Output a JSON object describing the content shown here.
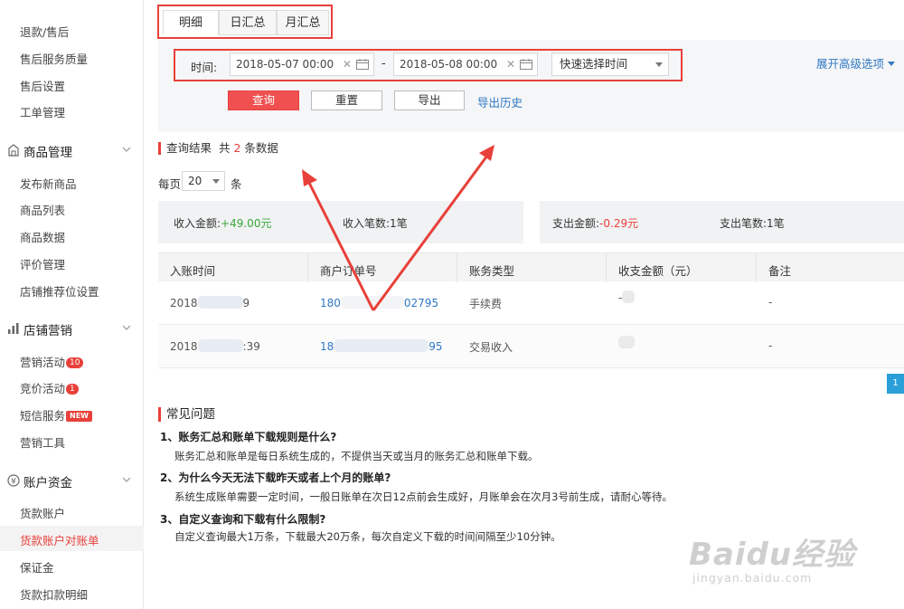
{
  "sidebar": {
    "top_items": [
      "退款/售后",
      "售后服务质量",
      "售后设置",
      "工单管理"
    ],
    "groups": [
      {
        "label": "商品管理",
        "items": [
          "发布新商品",
          "商品列表",
          "商品数据",
          "评价管理",
          "店铺推荐位设置"
        ]
      },
      {
        "label": "店铺营销",
        "items": [
          "营销活动",
          "竞价活动",
          "短信服务",
          "营销工具"
        ],
        "badges": {
          "营销活动": "10",
          "竞价活动": "1",
          "短信服务": "NEW"
        }
      },
      {
        "label": "账户资金",
        "items": [
          "货款账户",
          "货款账户对账单",
          "保证金",
          "货款扣款明细"
        ]
      }
    ],
    "active_item": "货款账户对账单"
  },
  "tabs": [
    "明细",
    "日汇总",
    "月汇总"
  ],
  "active_tab": "明细",
  "filter": {
    "time_label": "时间:",
    "start": "2018-05-07 00:00",
    "end": "2018-05-08 00:00",
    "dash": "-",
    "quick_select": "快速选择时间",
    "advanced": "展开高级选项",
    "buttons": {
      "query": "查询",
      "reset": "重置",
      "export": "导出"
    },
    "export_history": "导出历史"
  },
  "result": {
    "prefix": "查询结果",
    "total_prefix": "共",
    "count": "2",
    "suffix": "条数据"
  },
  "per_page": {
    "label": "每页",
    "value": "20",
    "unit": "条"
  },
  "summary": {
    "income_amount_label": "收入金额:",
    "income_amount": "+49.00元",
    "income_count_label": "收入笔数:",
    "income_count": "1笔",
    "expense_amount_label": "支出金额:",
    "expense_amount": "-0.29元",
    "expense_count_label": "支出笔数:",
    "expense_count": "1笔"
  },
  "table": {
    "headers": [
      "入账时间",
      "商户订单号",
      "账务类型",
      "收支金额（元）",
      "备注"
    ],
    "rows": [
      {
        "time_start": "2018",
        "time_end": "9",
        "order_start": "180",
        "order_end": "02795",
        "type": "手续费",
        "amount": "-",
        "note": "-"
      },
      {
        "time_start": "2018",
        "time_end": ":39",
        "order_start": "18",
        "order_end": "95",
        "type": "交易收入",
        "amount": "",
        "note": "-"
      }
    ]
  },
  "pager": {
    "current": "1"
  },
  "faq": {
    "title": "常见问题",
    "items": [
      {
        "q": "1、账务汇总和账单下载规则是什么?",
        "a": "账务汇总和账单是每日系统生成的，不提供当天或当月的账务汇总和账单下载。"
      },
      {
        "q": "2、为什么今天无法下载昨天或者上个月的账单?",
        "a": "系统生成账单需要一定时间，一般日账单在次日12点前会生成好，月账单会在次月3号前生成，请耐心等待。"
      },
      {
        "q": "3、自定义查询和下载有什么限制?",
        "a": "自定义查询最大1万条，下载最大20万条，每次自定义下载的时间间隔至少10分钟。"
      }
    ]
  },
  "watermark": {
    "brand": "Baidu经验",
    "url": "jingyan.baidu.com"
  },
  "colors": {
    "accent": "#e8403a",
    "link": "#2f78c4",
    "income": "#3aa73a",
    "pager": "#2a9fd8"
  }
}
